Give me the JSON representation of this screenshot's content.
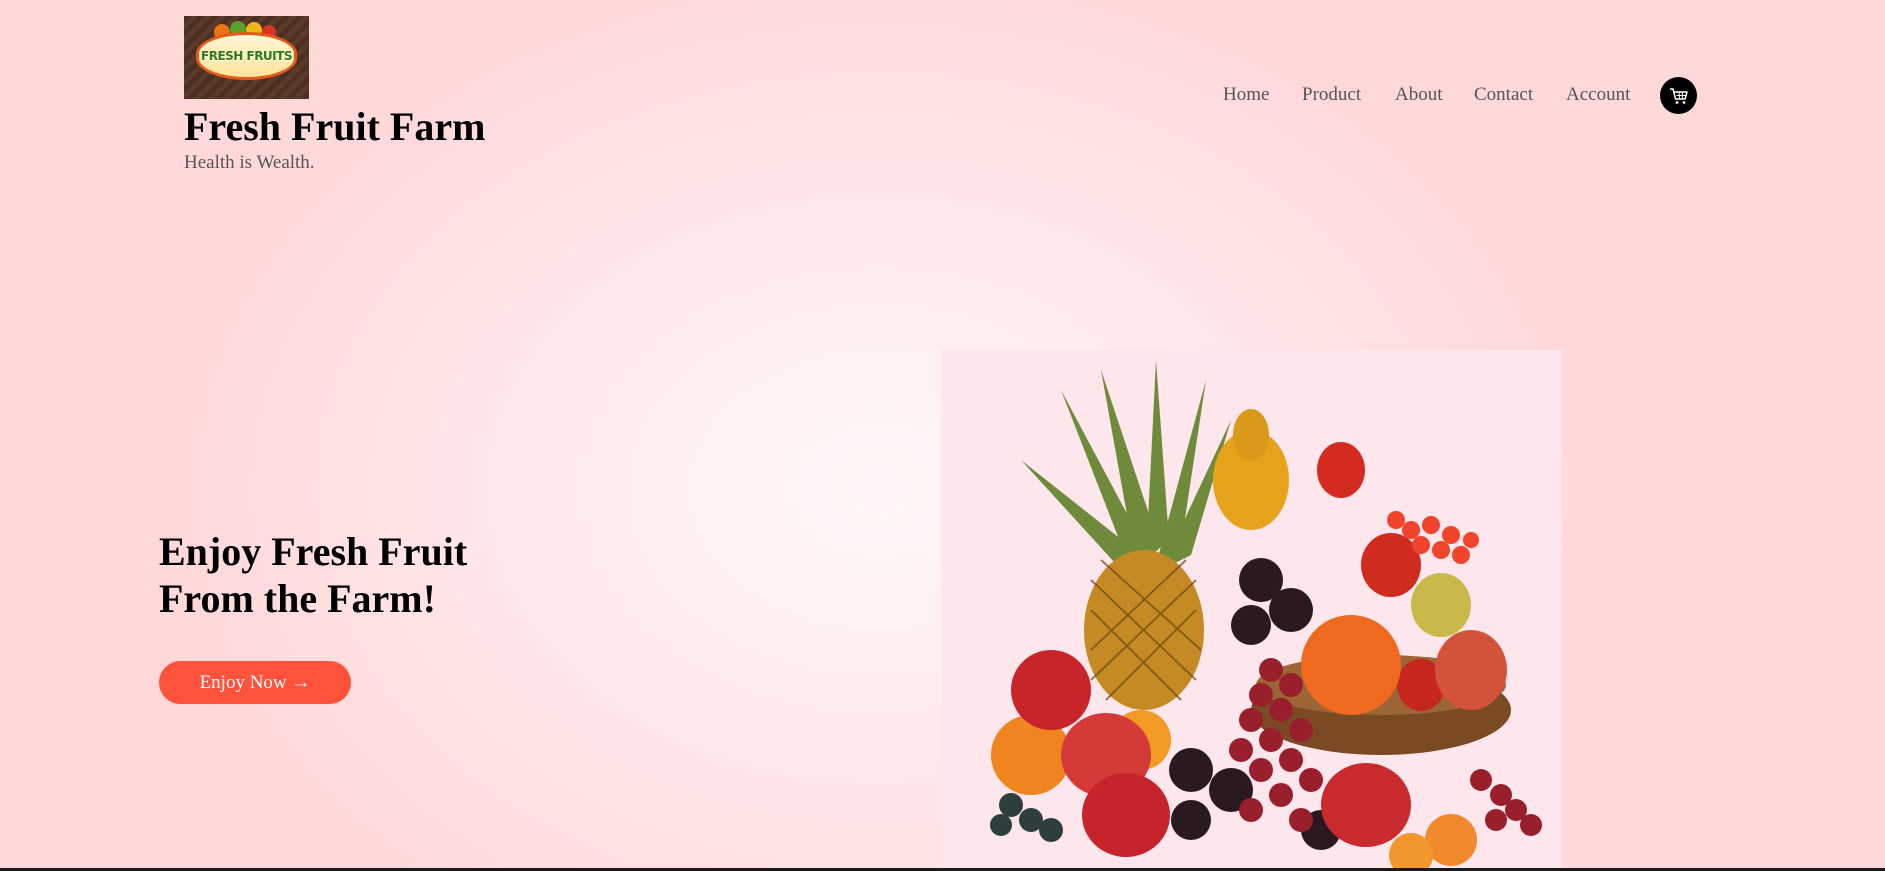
{
  "header": {
    "logo_alt": "FRESH FRUITS",
    "site_title": "Fresh Fruit Farm",
    "tagline": "Health is Wealth."
  },
  "nav": {
    "items": [
      {
        "label": "Home"
      },
      {
        "label": "Product"
      },
      {
        "label": "About"
      },
      {
        "label": "Contact"
      },
      {
        "label": "Account"
      }
    ],
    "cart_icon": "shopping-cart-icon"
  },
  "hero": {
    "title_line1": "Enjoy Fresh Fruit",
    "title_line2": "From the Farm!",
    "cta_label": "Enjoy Now →",
    "image_alt": "fruit-basket-image"
  },
  "colors": {
    "accent": "#ff523b",
    "background": "#ffe3e5",
    "cart_bg": "#000000",
    "nav_text": "#555555"
  }
}
